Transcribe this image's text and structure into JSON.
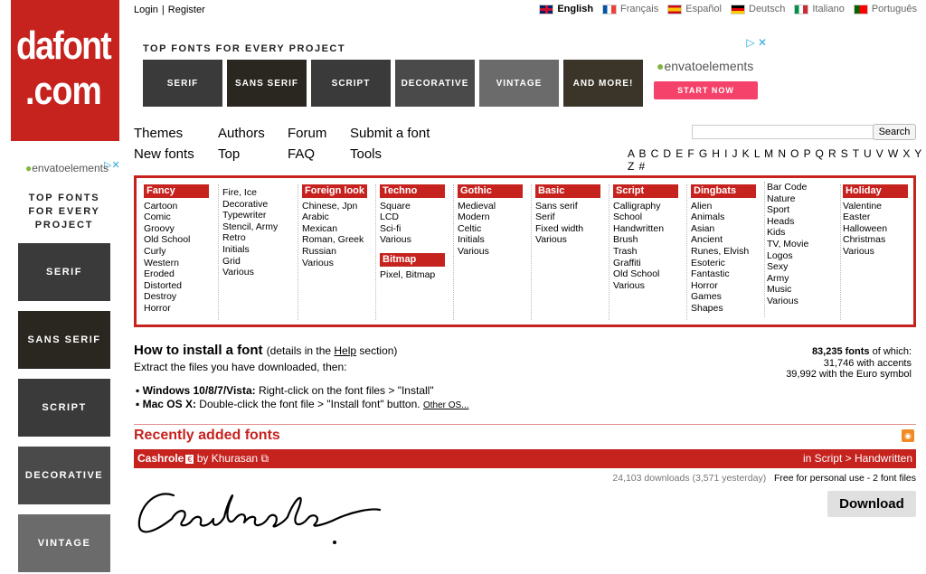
{
  "logo": {
    "line1": "dafont",
    "line2": ".com"
  },
  "account": {
    "login": "Login",
    "separator": "|",
    "register": "Register"
  },
  "languages": [
    {
      "label": "English",
      "active": true,
      "flag": "uk-flag-icon"
    },
    {
      "label": "Français",
      "active": false,
      "flag": "fr-flag-icon"
    },
    {
      "label": "Español",
      "active": false,
      "flag": "es-flag-icon"
    },
    {
      "label": "Deutsch",
      "active": false,
      "flag": "de-flag-icon"
    },
    {
      "label": "Italiano",
      "active": false,
      "flag": "it-flag-icon"
    },
    {
      "label": "Português",
      "active": false,
      "flag": "pt-flag-icon"
    }
  ],
  "top_ad": {
    "title": "TOP FONTS FOR EVERY PROJECT",
    "tiles": [
      "SERIF",
      "SANS SERIF",
      "SCRIPT",
      "DECORATIVE",
      "VINTAGE",
      "AND MORE!"
    ],
    "brand": "envatoelements",
    "cta": "START NOW"
  },
  "nav": {
    "themes": "Themes",
    "authors": "Authors",
    "forum": "Forum",
    "submit": "Submit a font",
    "new_fonts": "New fonts",
    "top": "Top",
    "faq": "FAQ",
    "tools": "Tools"
  },
  "search": {
    "value": "",
    "button": "Search"
  },
  "alphabet": "A B C D E F G H I J K L M N O P Q R S T U V W X Y Z #",
  "categories": [
    {
      "head": "Fancy",
      "items": [
        "Cartoon",
        "Comic",
        "Groovy",
        "Old School",
        "Curly",
        "Western",
        "Eroded",
        "Distorted",
        "Destroy",
        "Horror"
      ]
    },
    {
      "head": "",
      "items": [
        "Fire, Ice",
        "Decorative",
        "Typewriter",
        "Stencil, Army",
        "Retro",
        "Initials",
        "Grid",
        "Various"
      ]
    },
    {
      "head": "Foreign look",
      "items": [
        "Chinese, Jpn",
        "Arabic",
        "Mexican",
        "Roman, Greek",
        "Russian",
        "Various"
      ]
    },
    {
      "head": "Techno",
      "items": [
        "Square",
        "LCD",
        "Sci-fi",
        "Various"
      ],
      "head2": "Bitmap",
      "items2": [
        "Pixel, Bitmap"
      ]
    },
    {
      "head": "Gothic",
      "items": [
        "Medieval",
        "Modern",
        "Celtic",
        "Initials",
        "Various"
      ]
    },
    {
      "head": "Basic",
      "items": [
        "Sans serif",
        "Serif",
        "Fixed width",
        "Various"
      ]
    },
    {
      "head": "Script",
      "items": [
        "Calligraphy",
        "School",
        "Handwritten",
        "Brush",
        "Trash",
        "Graffiti",
        "Old School",
        "Various"
      ]
    },
    {
      "head": "Dingbats",
      "items": [
        "Alien",
        "Animals",
        "Asian",
        "Ancient",
        "Runes, Elvish",
        "Esoteric",
        "Fantastic",
        "Horror",
        "Games",
        "Shapes"
      ]
    },
    {
      "head": "",
      "items": [
        "Bar Code",
        "Nature",
        "Sport",
        "Heads",
        "Kids",
        "TV, Movie",
        "Logos",
        "Sexy",
        "Army",
        "Music",
        "Various"
      ]
    },
    {
      "head": "Holiday",
      "items": [
        "Valentine",
        "Easter",
        "Halloween",
        "Christmas",
        "Various"
      ]
    }
  ],
  "install": {
    "title": "How to install a font",
    "details_pre": "(details in the ",
    "details_link": "Help",
    "details_post": " section)",
    "extract": "Extract the files you have downloaded, then:",
    "win_label": "Windows 10/8/7/Vista:",
    "win_text": " Right-click on the font files > \"Install\"",
    "mac_label": "Mac OS X:",
    "mac_text": " Double-click the font file > \"Install font\" button.",
    "other_os": "Other OS..."
  },
  "stats": {
    "count": "83,235 fonts",
    "count_suffix": " of which:",
    "accents": "31,746 with accents",
    "euro": "39,992 with the Euro symbol"
  },
  "recent": {
    "title": "Recently added fonts",
    "font_name": "Cashrole",
    "badge": "€",
    "by": " by Khurasan",
    "category": "in Script > Handwritten",
    "downloads": "24,103 downloads (3,571 yesterday)",
    "license": "Free for personal use - 2 font files",
    "download_button": "Download",
    "preview_text": "Cashrole"
  },
  "left_ad": {
    "brand": "envatoelements",
    "title": "TOP FONTS FOR EVERY PROJECT",
    "tiles": [
      "SERIF",
      "SANS SERIF",
      "SCRIPT",
      "DECORATIVE",
      "VINTAGE"
    ]
  },
  "colors": {
    "brand_red": "#c6231f",
    "envato_green": "#82b540",
    "cta_pink": "#f5426a"
  }
}
